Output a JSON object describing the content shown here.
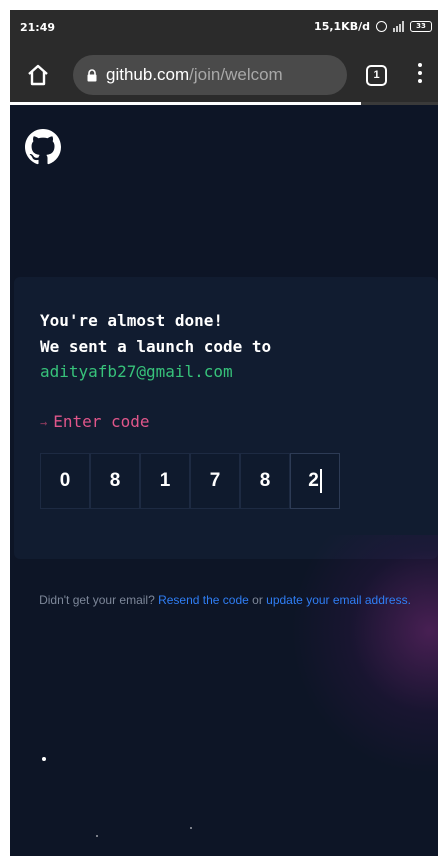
{
  "status_bar": {
    "time": "21:49",
    "network_speed": "15,1KB/d",
    "battery": "33"
  },
  "browser": {
    "url_domain": "github.com",
    "url_path": "/join/welcom",
    "tab_count": "1",
    "load_progress_percent": 82
  },
  "card": {
    "line1": "You're almost done!",
    "line2": "We sent a launch code to",
    "email": "adityafb27@gmail.com",
    "enter_code_arrow": "→",
    "enter_code_label": "Enter code",
    "code_digits": [
      "0",
      "8",
      "1",
      "7",
      "8",
      "2"
    ]
  },
  "resend": {
    "prefix": "Didn't get your email? ",
    "resend_link": "Resend the code",
    "or_text": " or ",
    "update_link": "update your email address",
    "suffix": "."
  },
  "colors": {
    "page_bg": "#0d1526",
    "card_bg": "#111c30",
    "email_green": "#37c27a",
    "enter_code_pink": "#e0568a",
    "link_blue": "#2f7ef5"
  },
  "icons": [
    "home-icon",
    "lock-icon",
    "tab-switcher-icon",
    "menu-icon",
    "github-logo",
    "alarm-icon",
    "signal-icon",
    "battery-icon"
  ]
}
